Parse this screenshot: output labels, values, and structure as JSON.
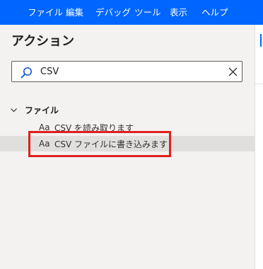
{
  "menubar": {
    "items": [
      "ファイル",
      "編集",
      "デバッグ",
      "ツール",
      "表示",
      "ヘルプ"
    ]
  },
  "colors": {
    "menubar_bg": "#0066ff",
    "highlight": "#e0201c",
    "selected_row": "#e1dfdd"
  },
  "panel": {
    "title": "アクション",
    "search": {
      "value": "CSV",
      "icon": "search-icon",
      "clear_icon": "close-icon"
    },
    "group": {
      "label": "ファイル",
      "expanded": true,
      "icon": "chevron-down-icon"
    },
    "actions": [
      {
        "icon_text": "Aa",
        "label": "CSV を読み取ります",
        "selected": false
      },
      {
        "icon_text": "Aa",
        "label": "CSV ファイルに書き込みます",
        "selected": true
      }
    ]
  }
}
